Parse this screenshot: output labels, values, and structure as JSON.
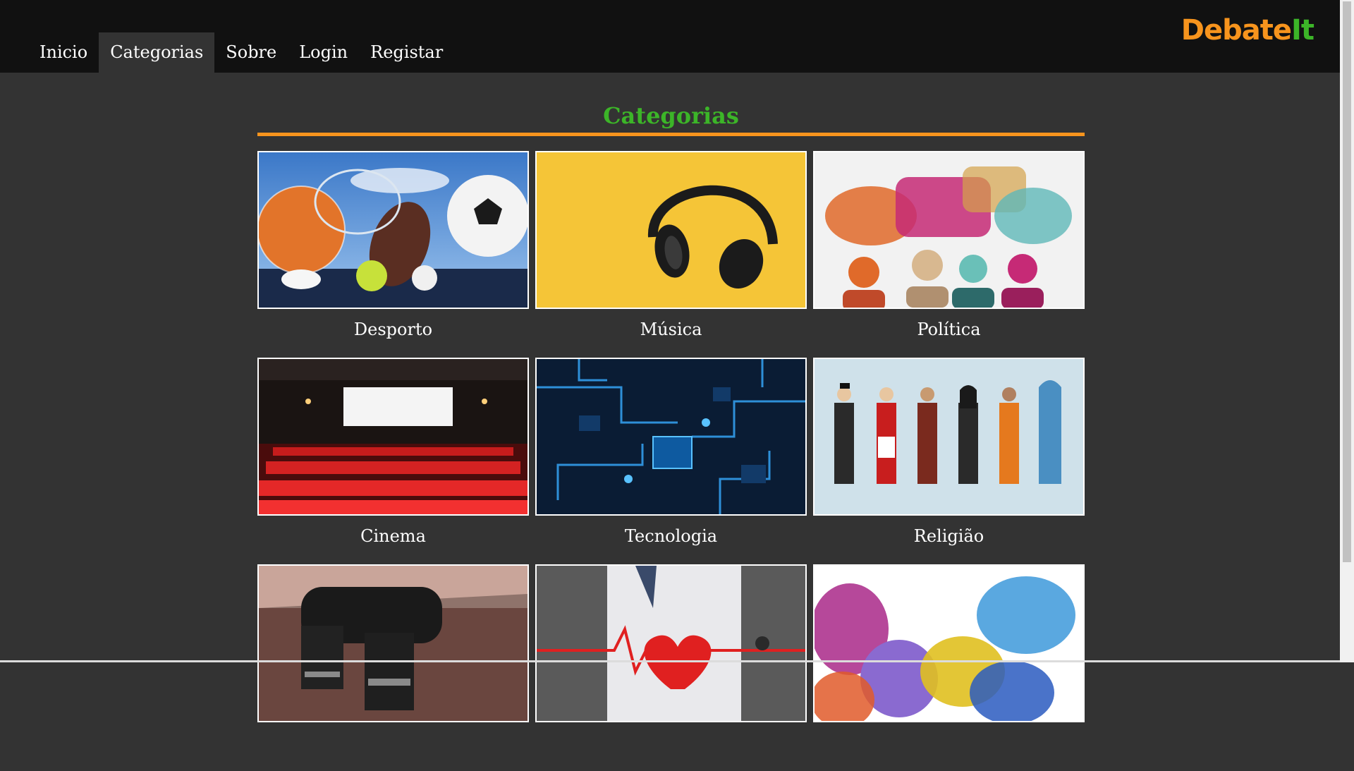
{
  "nav": {
    "items": [
      {
        "label": "Inicio",
        "active": false
      },
      {
        "label": "Categorias",
        "active": true
      },
      {
        "label": "Sobre",
        "active": false
      },
      {
        "label": "Login",
        "active": false
      },
      {
        "label": "Registar",
        "active": false
      }
    ]
  },
  "logo": {
    "part1": "Debate",
    "part2": "It",
    "color1": "#f7941d",
    "color2": "#3cb528"
  },
  "page": {
    "title": "Categorias",
    "title_color": "#3cb528",
    "rule_color": "#f7941d"
  },
  "categories": [
    {
      "label": "Desporto",
      "image": "sports-balls-image"
    },
    {
      "label": "Música",
      "image": "headphones-image"
    },
    {
      "label": "Política",
      "image": "speech-bubbles-people-image"
    },
    {
      "label": "Cinema",
      "image": "cinema-hall-image"
    },
    {
      "label": "Tecnologia",
      "image": "circuit-board-image"
    },
    {
      "label": "Religião",
      "image": "religious-figures-image"
    },
    {
      "label": "",
      "image": "microscope-image"
    },
    {
      "label": "",
      "image": "doctor-heart-image"
    },
    {
      "label": "",
      "image": "colorful-heads-image"
    }
  ]
}
